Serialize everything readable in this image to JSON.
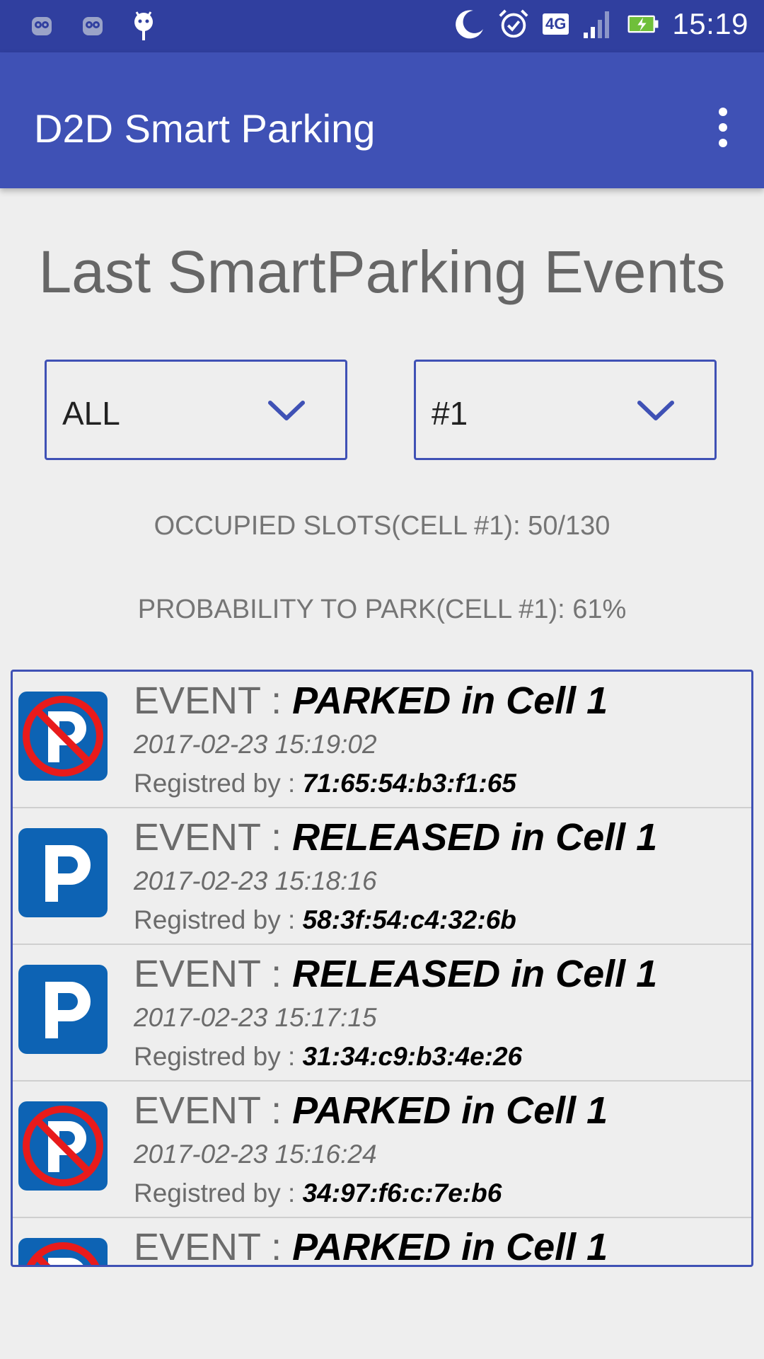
{
  "status_bar": {
    "time": "15:19",
    "network": "4G",
    "icons": [
      "owl-icon",
      "owl-icon",
      "android-icon",
      "moon-icon",
      "alarm-icon",
      "signal-icon",
      "battery-charging-icon"
    ]
  },
  "app_bar": {
    "title": "D2D Smart Parking",
    "menu_icon": "overflow-menu-icon"
  },
  "heading": "Last SmartParking Events",
  "filters": {
    "event_type": {
      "selected": "ALL"
    },
    "cell": {
      "selected": "#1"
    }
  },
  "stats": {
    "occupied": "OCCUPIED SLOTS(CELL #1): 50/130",
    "probability": "PROBABILITY TO PARK(CELL #1): 61%"
  },
  "colors": {
    "status_bar": "#303f9f",
    "app_bar": "#3f51b5",
    "accent": "#3f51b5",
    "parking_blue": "#0d63b4",
    "no_parking_red": "#e81b1b"
  },
  "events": [
    {
      "prefix": "EVENT : ",
      "value": "PARKED in Cell 1",
      "time": "2017-02-23 15:19:02",
      "by_label": "Registred by : ",
      "mac": "71:65:54:b3:f1:65",
      "icon": "no-parking-icon"
    },
    {
      "prefix": "EVENT : ",
      "value": "RELEASED in Cell 1",
      "time": "2017-02-23 15:18:16",
      "by_label": "Registred by : ",
      "mac": "58:3f:54:c4:32:6b",
      "icon": "parking-icon"
    },
    {
      "prefix": "EVENT : ",
      "value": "RELEASED in Cell 1",
      "time": "2017-02-23 15:17:15",
      "by_label": "Registred by : ",
      "mac": "31:34:c9:b3:4e:26",
      "icon": "parking-icon"
    },
    {
      "prefix": "EVENT : ",
      "value": "PARKED in Cell 1",
      "time": "2017-02-23 15:16:24",
      "by_label": "Registred by : ",
      "mac": "34:97:f6:c:7e:b6",
      "icon": "no-parking-icon"
    },
    {
      "prefix": "EVENT : ",
      "value": "PARKED in Cell 1",
      "icon": "no-parking-icon"
    }
  ]
}
